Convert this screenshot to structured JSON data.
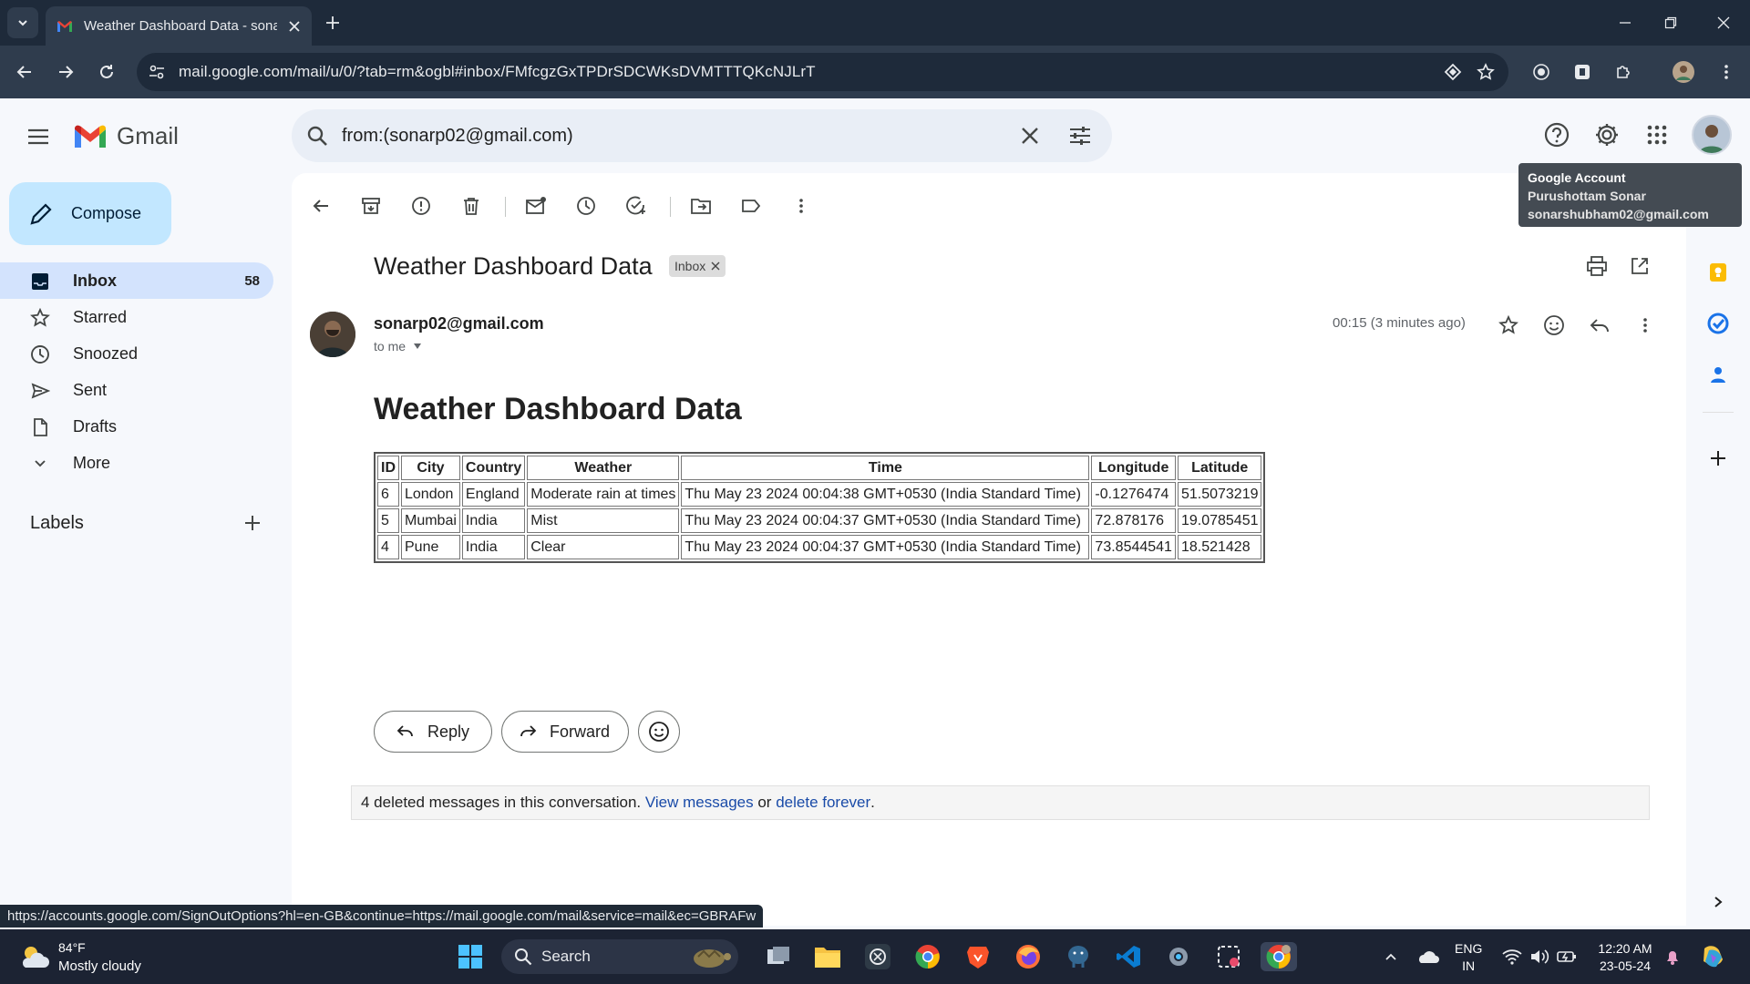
{
  "browser": {
    "tab_title": "Weather Dashboard Data - sonarp02@gmail.com",
    "url": "mail.google.com/mail/u/0/?tab=rm&ogbl#inbox/FMfcgzGxTPDrSDCWKsDVMTTTQKcNJLrT",
    "status_url": "https://accounts.google.com/SignOutOptions?hl=en-GB&continue=https://mail.google.com/mail&service=mail&ec=GBRAFw"
  },
  "gmail": {
    "logo_text": "Gmail",
    "search_query": "from:(sonarp02@gmail.com)",
    "compose_label": "Compose",
    "nav": [
      {
        "label": "Inbox",
        "count": "58"
      },
      {
        "label": "Starred"
      },
      {
        "label": "Snoozed"
      },
      {
        "label": "Sent"
      },
      {
        "label": "Drafts"
      },
      {
        "label": "More"
      }
    ],
    "labels_heading": "Labels",
    "tooltip": {
      "title": "Google Account",
      "name": "Purushottam Sonar",
      "email": "sonarshubham02@gmail.com"
    }
  },
  "email": {
    "subject": "Weather Dashboard Data",
    "label_badge": "Inbox",
    "sender": "sonarp02@gmail.com",
    "recipient": "to me",
    "timestamp": "00:15 (3 minutes ago)",
    "body_title": "Weather Dashboard Data",
    "table": {
      "headers": [
        "ID",
        "City",
        "Country",
        "Weather",
        "Time",
        "Longitude",
        "Latitude"
      ],
      "rows": [
        [
          "6",
          "London",
          "England",
          "Moderate rain at times",
          "Thu May 23 2024 00:04:38 GMT+0530 (India Standard Time)",
          "-0.1276474",
          "51.5073219"
        ],
        [
          "5",
          "Mumbai",
          "India",
          "Mist",
          "Thu May 23 2024 00:04:37 GMT+0530 (India Standard Time)",
          "72.878176",
          "19.0785451"
        ],
        [
          "4",
          "Pune",
          "India",
          "Clear",
          "Thu May 23 2024 00:04:37 GMT+0530 (India Standard Time)",
          "73.8544541",
          "18.521428"
        ]
      ]
    },
    "reply_label": "Reply",
    "forward_label": "Forward",
    "deleted_notice": {
      "prefix": "4 deleted messages in this conversation.",
      "view_link": "View messages",
      "or": "or",
      "delete_link": "delete forever",
      "suffix": "."
    }
  },
  "taskbar": {
    "weather_temp": "84°F",
    "weather_desc": "Mostly cloudy",
    "search_label": "Search",
    "lang_line1": "ENG",
    "lang_line2": "IN",
    "time": "12:20 AM",
    "date": "23-05-24"
  },
  "colors": {
    "compose_bg": "#c2e7ff",
    "active_nav_bg": "#d3e3fd",
    "link": "#1a4ba8",
    "chrome_dark": "#1e2a3a"
  }
}
